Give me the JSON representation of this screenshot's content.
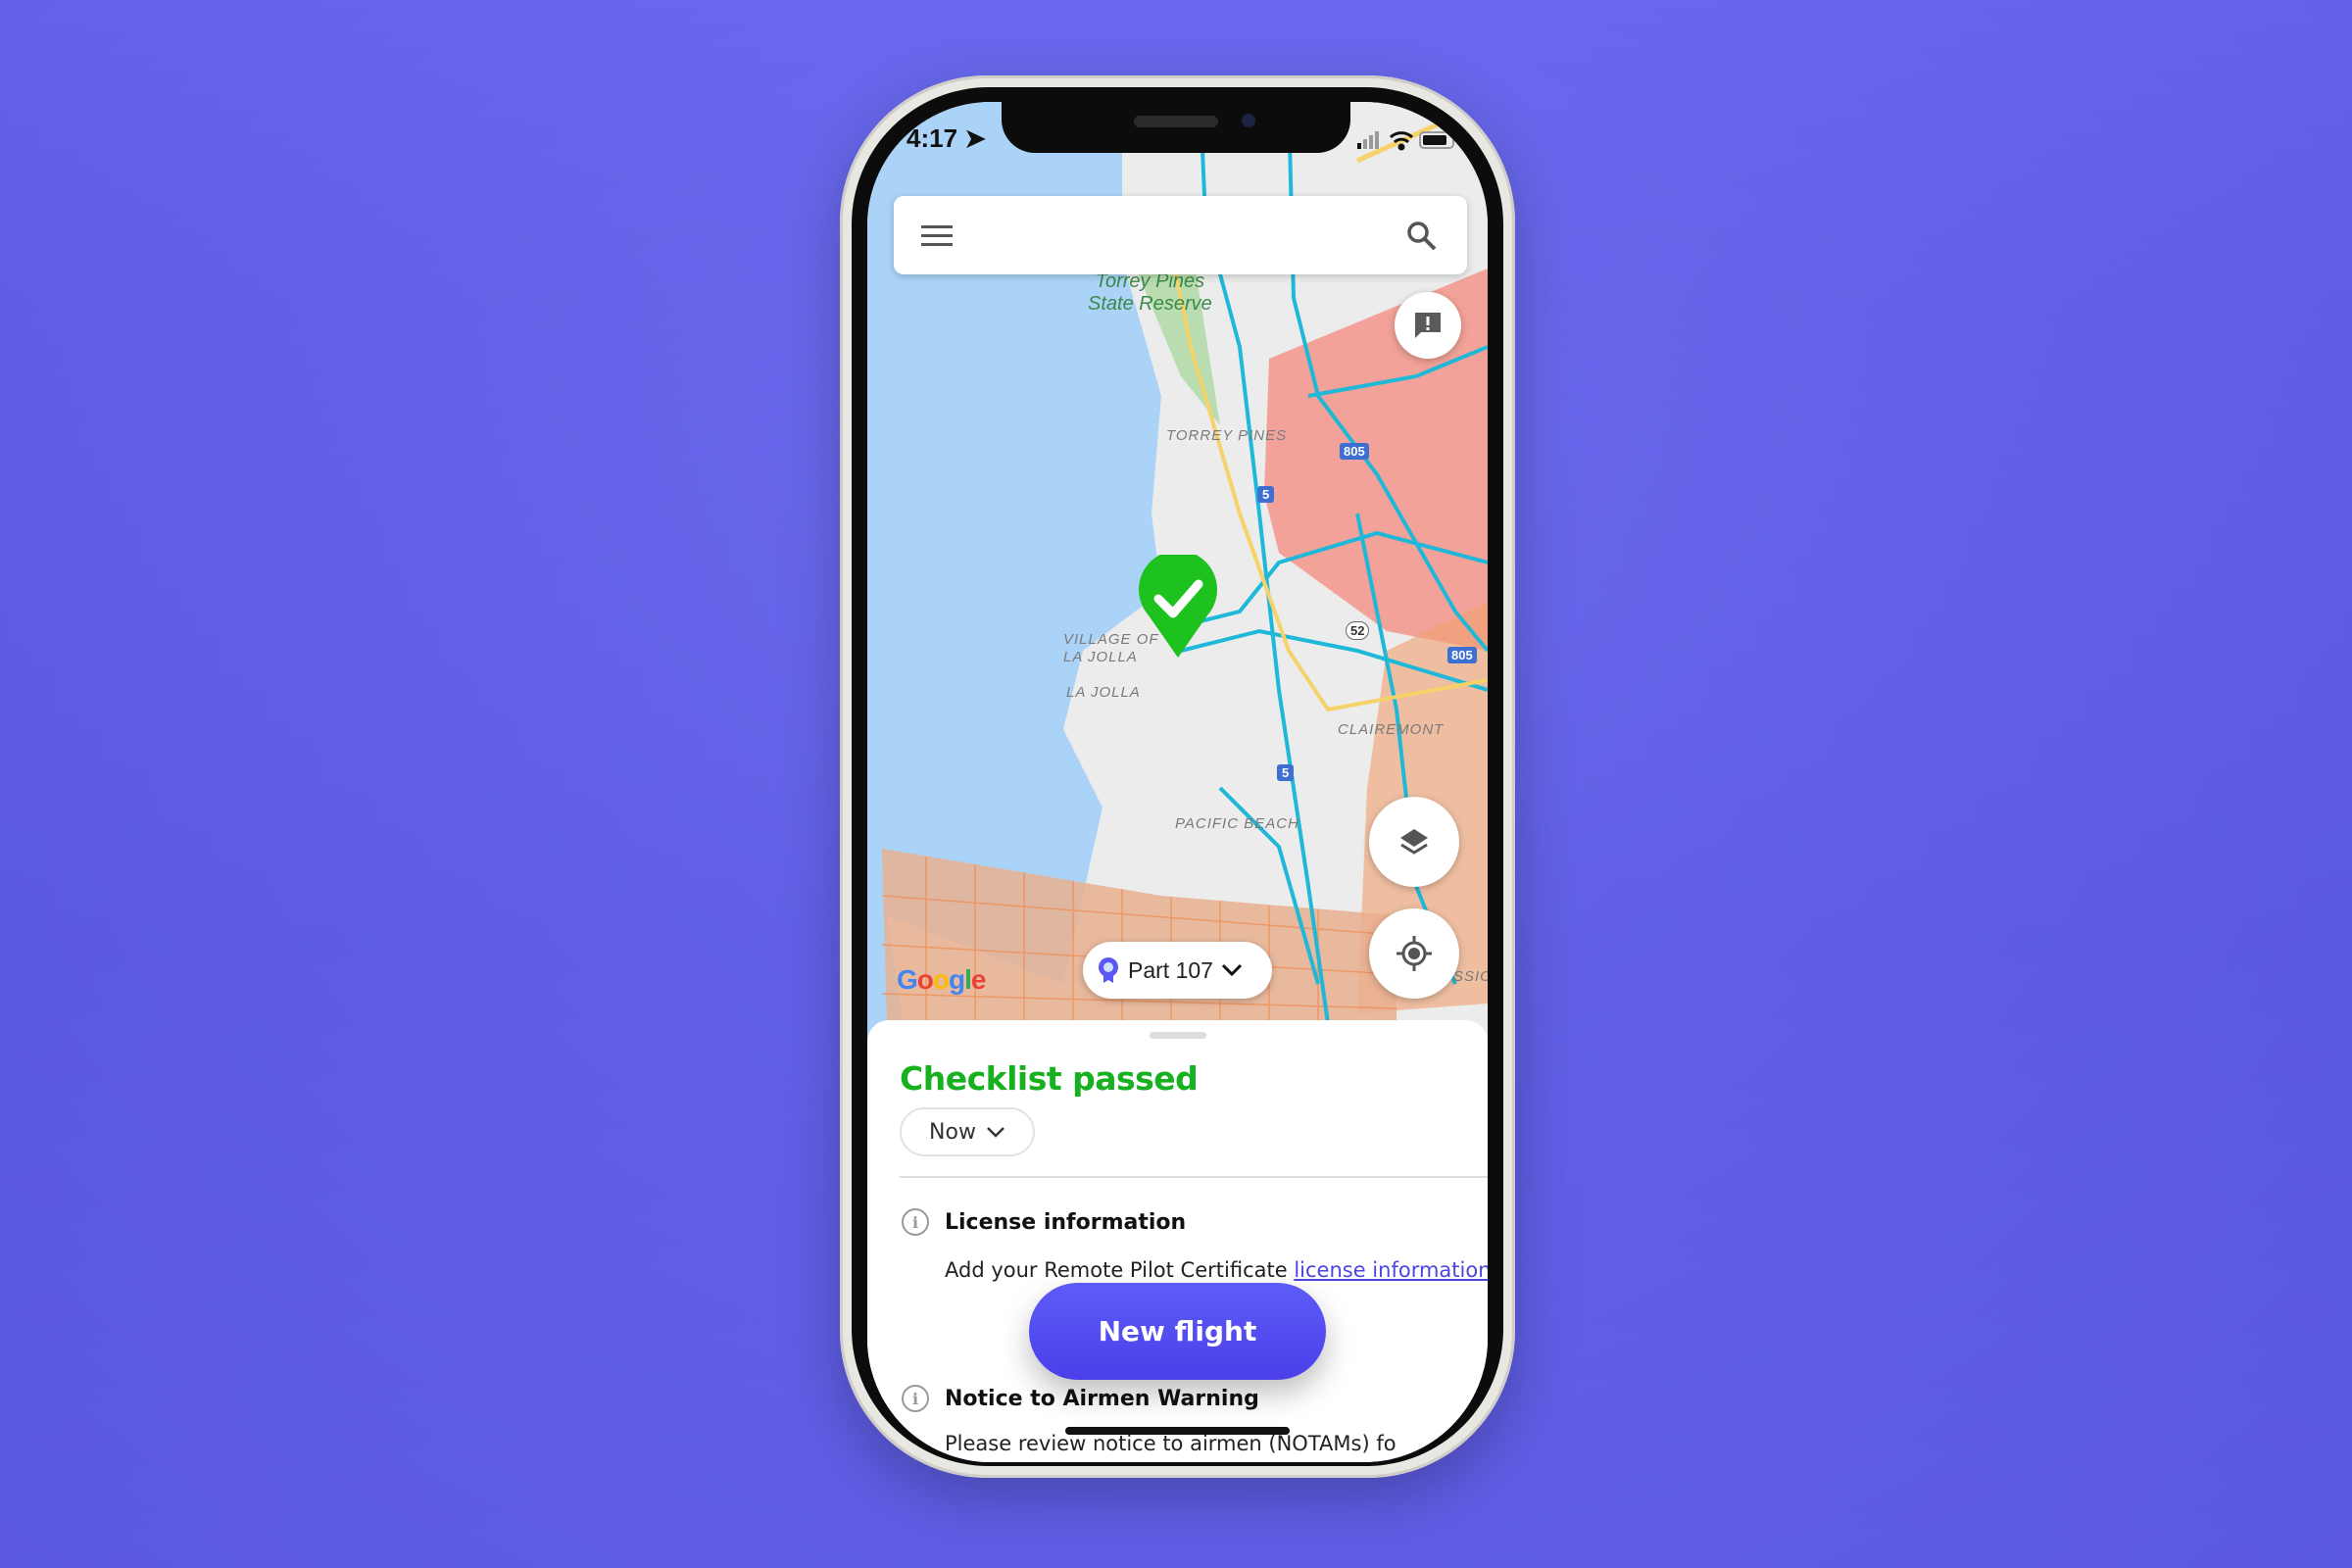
{
  "status_bar": {
    "time": "4:17",
    "location_icon": "location-arrow-icon",
    "signal_icon": "cellular-signal-icon",
    "wifi_icon": "wifi-icon",
    "battery_icon": "battery-icon"
  },
  "search_bar": {
    "menu_icon": "hamburger-menu-icon",
    "search_icon": "search-icon"
  },
  "map": {
    "labels": {
      "torrey_pines_reserve_1": "Torrey Pines",
      "torrey_pines_reserve_2": "State Reserve",
      "torrey_pines": "TORREY PINES",
      "village_1": "VILLAGE OF",
      "village_2": "LA JOLLA",
      "la_jolla": "LA JOLLA",
      "clairemont": "CLAIREMONT",
      "pacific_beach": "PACIFIC BEACH",
      "mission": "SSIO"
    },
    "highway_shields": [
      "805",
      "5",
      "52",
      "805",
      "5"
    ],
    "attribution": "Google",
    "pin_status": "passed",
    "colors": {
      "water": "#aad3f7",
      "land": "#ececec",
      "restricted_zone": "#f3958a",
      "grid_zone": "#e9b08f",
      "roads": "#1fb8d8",
      "pin": "#1ec21e"
    }
  },
  "map_controls": {
    "feedback_icon": "feedback-alert-icon",
    "layers_icon": "layers-icon",
    "locate_icon": "my-location-icon"
  },
  "rule_selector": {
    "label": "Part 107",
    "icon": "badge-icon"
  },
  "sheet": {
    "title": "Checklist passed",
    "time_select": "Now",
    "items": [
      {
        "heading": "License information",
        "text": "Add your Remote Pilot Certificate ",
        "link": "license information"
      },
      {
        "heading": "Notice to Airmen Warning",
        "text": "Please review notice to airmen (NOTAMs) fo"
      }
    ]
  },
  "primary_action": {
    "label": "New flight"
  },
  "colors": {
    "accent": "#5b57f2",
    "success": "#17b01f",
    "background": "#6664ea"
  }
}
